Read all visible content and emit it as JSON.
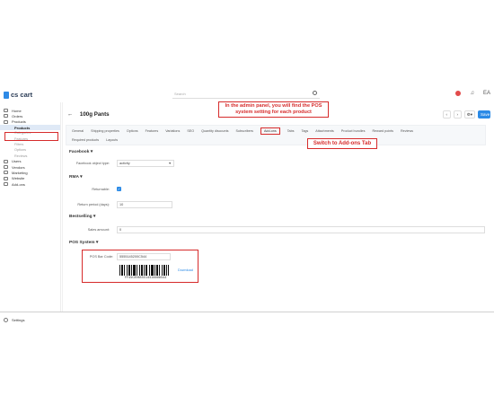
{
  "topbar": {
    "logo": "cs cart",
    "search_placeholder": "Search",
    "user_initials": "EA"
  },
  "sidebar": {
    "items": [
      {
        "label": "Home",
        "icon": "home-icon"
      },
      {
        "label": "Orders",
        "icon": "cart-icon"
      },
      {
        "label": "Products",
        "icon": "tag-icon"
      }
    ],
    "active_label": "Products",
    "subitems": [
      "Categories",
      "Features",
      "Filters",
      "Options",
      "Reviews"
    ],
    "items2": [
      {
        "label": "Users",
        "icon": "user-icon"
      },
      {
        "label": "Vendors",
        "icon": "vendors-icon"
      },
      {
        "label": "Marketing",
        "icon": "megaphone-icon"
      },
      {
        "label": "Website",
        "icon": "monitor-icon"
      },
      {
        "label": "Add-ons",
        "icon": "puzzle-icon"
      }
    ],
    "settings_label": "Settings"
  },
  "page": {
    "back": "←",
    "title": "100g Pants",
    "save_label": "Save"
  },
  "tabs": {
    "row1": [
      "General",
      "Shipping properties",
      "Options",
      "Features",
      "Variations",
      "SEO",
      "Quantity discounts",
      "Subscribers",
      "Add-ons",
      "Tabs",
      "Tags",
      "Attachments",
      "Product bundles",
      "Reward points",
      "Reviews"
    ],
    "row2": [
      "Required products",
      "Layouts"
    ]
  },
  "facebook": {
    "heading": "Facebook",
    "object_type_label": "Facebook object type:",
    "object_type_value": "activity"
  },
  "rma": {
    "heading": "RMA",
    "returnable_label": "Returnable:",
    "return_period_label": "Return period (days):",
    "return_period_value": "10"
  },
  "bestselling": {
    "heading": "Bestselling",
    "sales_amount_label": "Sales amount:",
    "sales_amount_value": "0"
  },
  "pos": {
    "heading": "POS System",
    "barcode_label": "POS Bar Code:",
    "barcode_value": "5555145200C544",
    "barcode_text": "FF45C89855514520000544",
    "download_label": "Download"
  },
  "callouts": {
    "admin": "In the admin panel, you will find the POS system setting for each product",
    "switch": "Switch to Add-ons Tab"
  },
  "colors": {
    "accent": "#2b8ae6",
    "annotation": "#d62b2b"
  }
}
